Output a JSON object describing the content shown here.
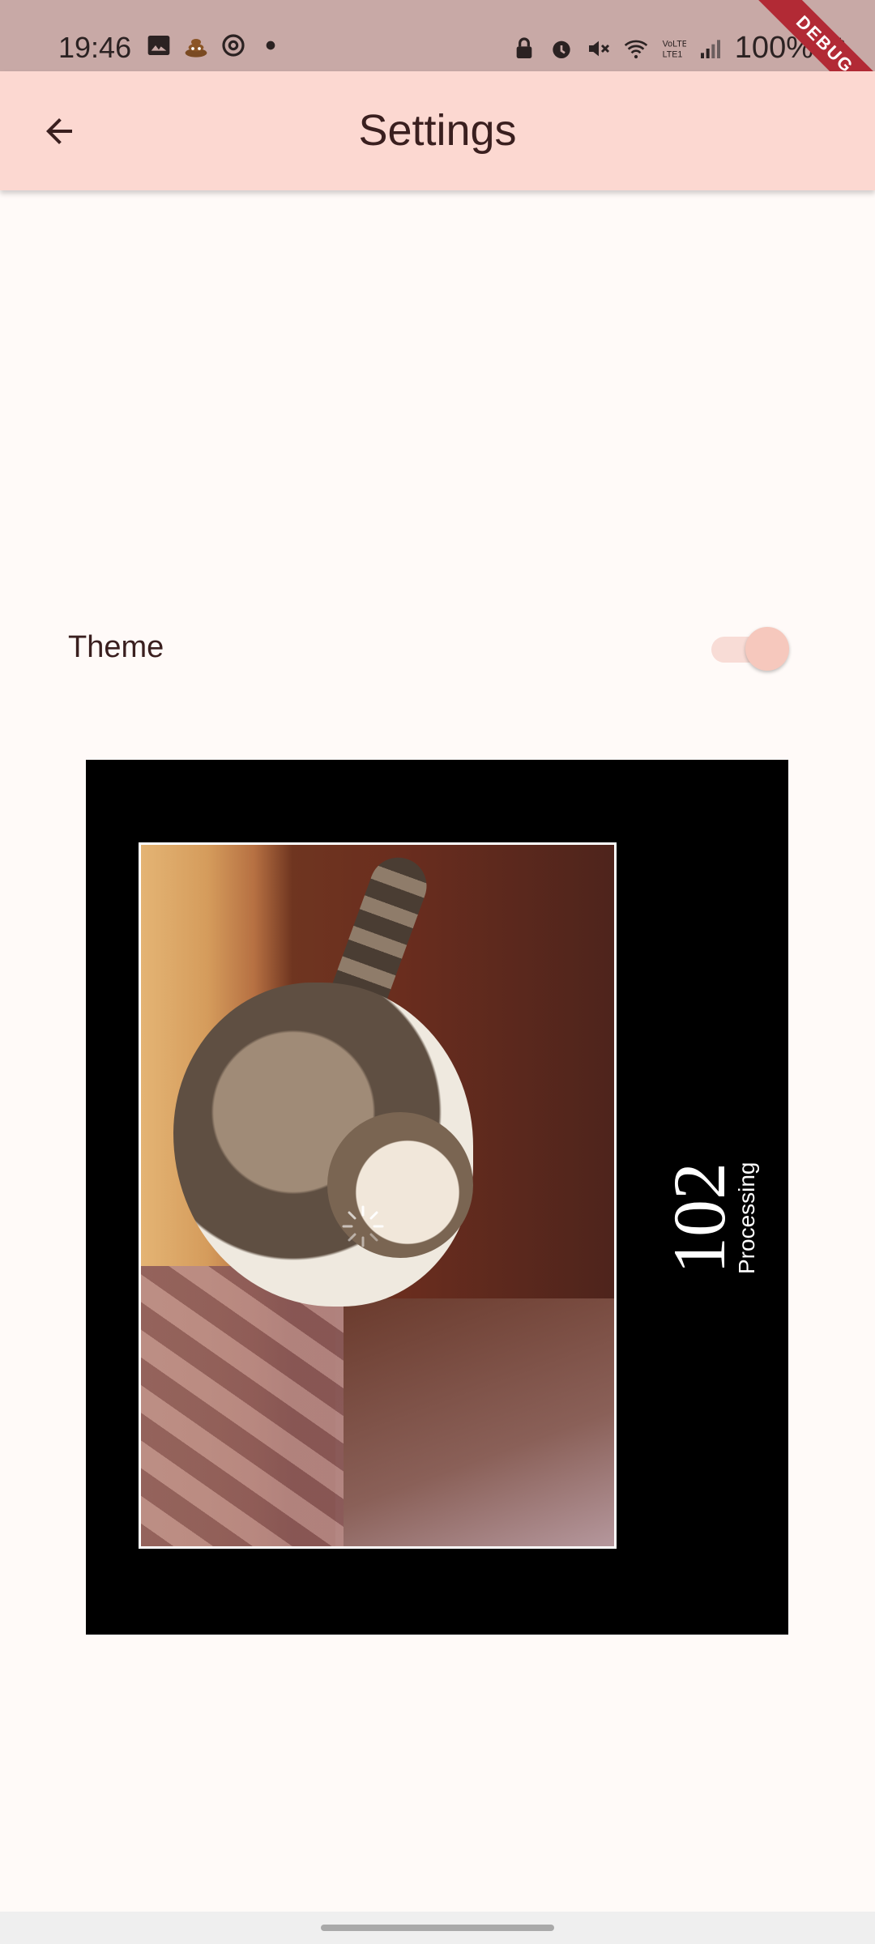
{
  "status_bar": {
    "time": "19:46",
    "left_icons": [
      "image-icon",
      "poop-emoji-icon",
      "at-icon",
      "dot-icon"
    ],
    "right_icons": [
      "lock-icon",
      "alarm-icon",
      "mute-icon",
      "wifi-icon",
      "volte-icon",
      "signal-icon",
      "battery-icon"
    ],
    "battery_text": "100%",
    "debug_label": "DEBUG"
  },
  "app_bar": {
    "title": "Settings",
    "back_icon": "arrow-back-icon"
  },
  "settings": {
    "theme_label": "Theme",
    "theme_toggle_on": true
  },
  "poster": {
    "number": "102",
    "caption": "Processing"
  },
  "colors": {
    "app_bar": "#fcd8d1",
    "background": "#fffaf8",
    "status_bar": "#c8a9a6",
    "debug_banner": "#b22a35"
  }
}
